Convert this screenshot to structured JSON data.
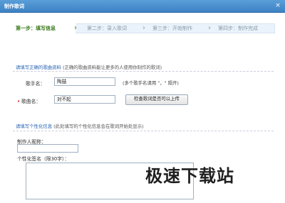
{
  "window": {
    "title": "制作歌词"
  },
  "steps": [
    {
      "label": "第一步：填写信息"
    },
    {
      "label": "第二步：录入歌词"
    },
    {
      "label": "第三步：开始制作"
    },
    {
      "label": "第四步：制作完成"
    }
  ],
  "section1": {
    "title": "请填写正确的歌曲资料",
    "note": "(正确的歌曲资料能让更多的人使用你制作的歌词)"
  },
  "singer": {
    "label": "歌手名：",
    "value": "陶喆",
    "hint": "(多个歌手名请用 \"，\" 隔开)"
  },
  "song": {
    "label": "歌曲名：",
    "value": "对不起",
    "check_button": "检查歌词是否可以上传"
  },
  "section2": {
    "title": "请填写个性化信息",
    "note": "(此处填写的个性化信息会在歌词开始处显示)"
  },
  "maker": {
    "label": "制作人昵称：",
    "value": ""
  },
  "signature": {
    "label": "个性化签名（限30字）：",
    "value": ""
  },
  "watermark": {
    "text": "极速下载站"
  }
}
